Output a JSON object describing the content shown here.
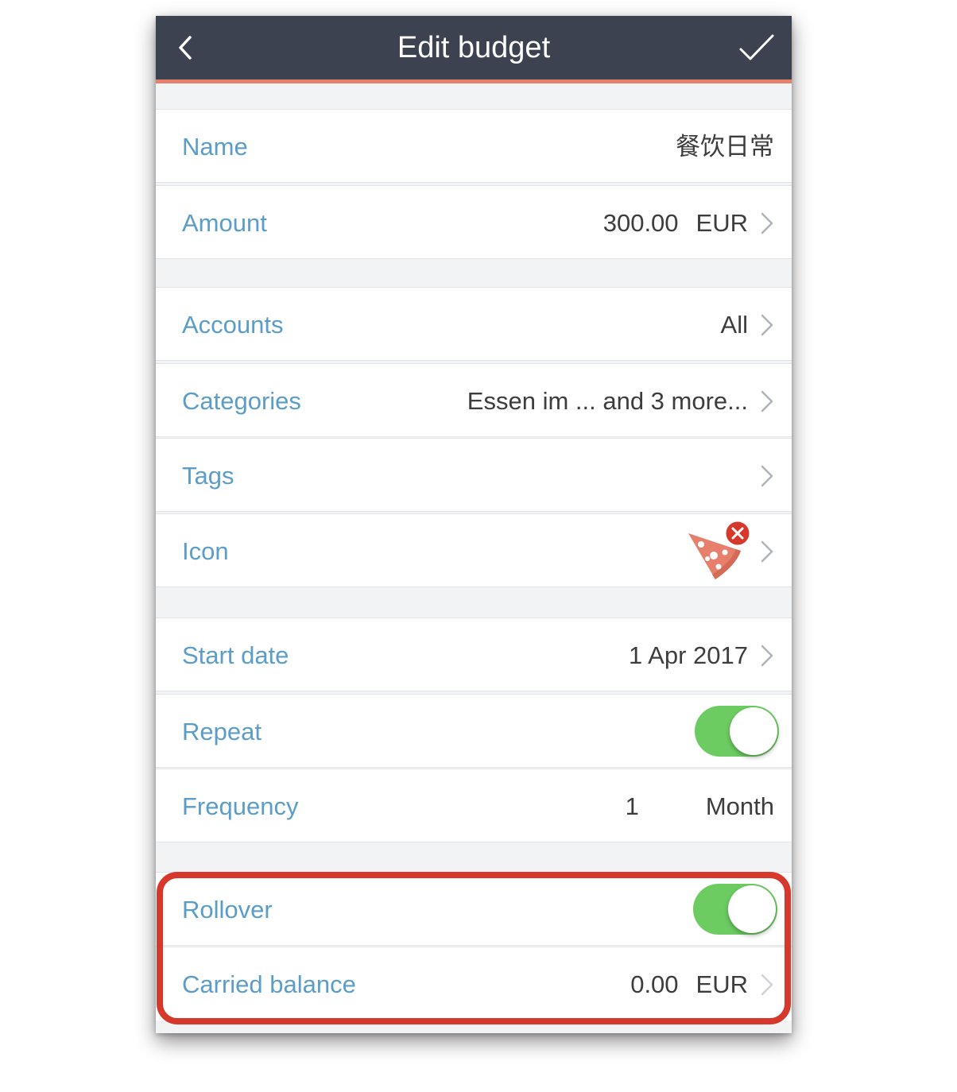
{
  "header": {
    "title": "Edit budget",
    "back_icon": "chevron-left-icon",
    "confirm_icon": "checkmark-icon",
    "background_color": "#3d4250",
    "accent_color": "#e6806c"
  },
  "rows": {
    "name": {
      "label": "Name",
      "value": "餐饮日常"
    },
    "amount": {
      "label": "Amount",
      "value": "300.00",
      "currency": "EUR"
    },
    "accounts": {
      "label": "Accounts",
      "value": "All"
    },
    "categories": {
      "label": "Categories",
      "value": "Essen im ... and 3 more..."
    },
    "tags": {
      "label": "Tags",
      "value": ""
    },
    "icon": {
      "label": "Icon",
      "icon": "pizza-icon",
      "remove_icon": "remove-badge-icon"
    },
    "start_date": {
      "label": "Start date",
      "value": "1 Apr 2017"
    },
    "repeat": {
      "label": "Repeat",
      "on": true
    },
    "frequency": {
      "label": "Frequency",
      "number": "1",
      "unit": "Month"
    },
    "rollover": {
      "label": "Rollover",
      "on": true
    },
    "carried_balance": {
      "label": "Carried balance",
      "value": "0.00",
      "currency": "EUR"
    }
  },
  "colors": {
    "label": "#5b9dc9",
    "toggle_on": "#6ccc61",
    "highlight": "#d6392b"
  }
}
